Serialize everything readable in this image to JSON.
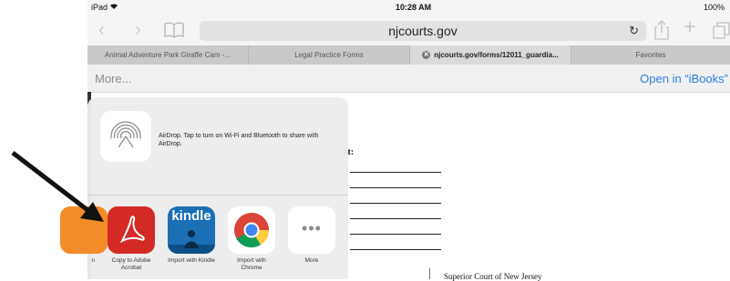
{
  "status_bar": {
    "carrier": "iPad",
    "time": "10:28 AM",
    "battery": "100%"
  },
  "address_bar": {
    "url": "njcourts.gov"
  },
  "tabs": [
    {
      "label": "Animal Adventure Park Giraffe Cam -..."
    },
    {
      "label": "Legal Practice Forms"
    },
    {
      "label": "njcourts.gov/forms/12011_guardia..."
    },
    {
      "label": "Favorites"
    }
  ],
  "toolbar": {
    "more_label": "More...",
    "open_in_label": "Open in “iBooks”"
  },
  "document": {
    "partial_heading": "nt:",
    "footer_text": "Superior Court of New Jersey"
  },
  "share_sheet": {
    "airdrop_text": "AirDrop. Tap to turn on Wi-Fi and Bluetooth to share with AirDrop.",
    "apps": [
      {
        "label": "n",
        "icon": "partial-app-icon"
      },
      {
        "label": "Copy to Adobe Acrobat",
        "icon": "adobe-acrobat-icon"
      },
      {
        "label": "Import with Kindle",
        "icon": "kindle-icon"
      },
      {
        "label": "Import with Chrome",
        "icon": "chrome-icon"
      },
      {
        "label": "More",
        "icon": "more-dots-icon"
      }
    ]
  },
  "colors": {
    "link_blue": "#2a7ee0",
    "acrobat_red": "#d42a25",
    "kindle_blue": "#1b6fb5",
    "arrow": "#111111"
  }
}
